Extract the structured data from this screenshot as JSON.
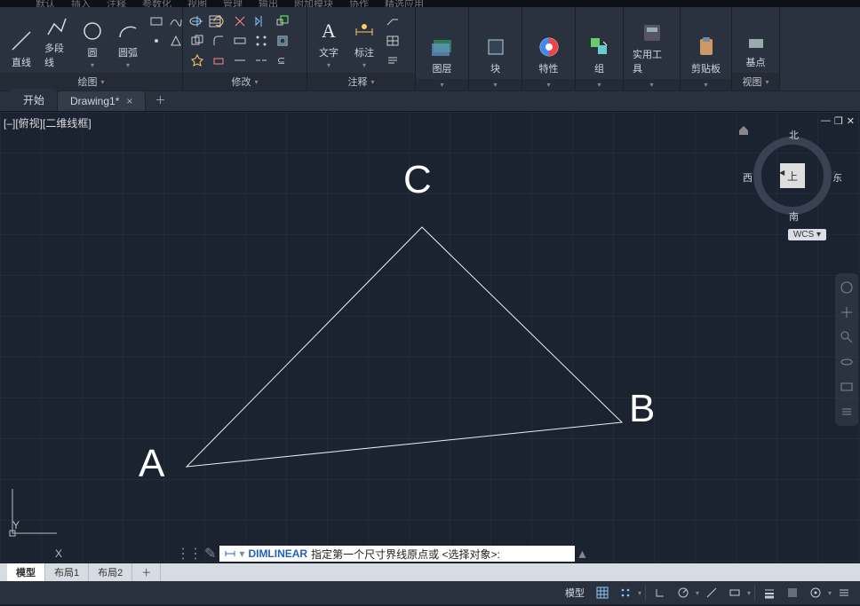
{
  "menubar": [
    "默认",
    "插入",
    "注释",
    "参数化",
    "视图",
    "管理",
    "输出",
    "附加模块",
    "协作",
    "精选应用"
  ],
  "ribbon": {
    "draw": {
      "label": "绘图",
      "line": "直线",
      "pline": "多段线",
      "circle": "圆",
      "arc": "圆弧"
    },
    "modify": {
      "label": "修改"
    },
    "annot": {
      "label": "注释",
      "text": "文字",
      "dim": "标注"
    },
    "layer": {
      "label": "图层"
    },
    "block": {
      "label": "块"
    },
    "props": {
      "label": "特性"
    },
    "group": {
      "label": "组"
    },
    "util": {
      "label": "实用工具"
    },
    "clip": {
      "label": "剪贴板"
    },
    "base": {
      "label": "基点",
      "view": "视图"
    }
  },
  "tabs": {
    "start": "开始",
    "drawing": "Drawing1*"
  },
  "viewport": {
    "label": "[–][俯视][二维线框]"
  },
  "vertices": {
    "A": "A",
    "B": "B",
    "C": "C"
  },
  "ucs": {
    "x": "X",
    "y": "Y"
  },
  "viewcube": {
    "face": "上",
    "n": "北",
    "s": "南",
    "e": "东",
    "w": "西",
    "wcs": "WCS"
  },
  "cmd": {
    "name": "DIMLINEAR",
    "prompt": "指定第一个尺寸界线原点或 <选择对象>:"
  },
  "layouts": {
    "model": "模型",
    "l1": "布局1",
    "l2": "布局2"
  },
  "status": {
    "model": "模型"
  }
}
